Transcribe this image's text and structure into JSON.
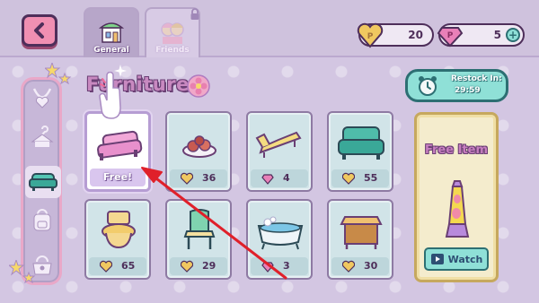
{
  "header": {
    "back_icon": "chevron-left-icon",
    "tabs": [
      {
        "label": "General",
        "icon": "shop-icon",
        "active": true
      },
      {
        "label": "Friends",
        "icon": "friends-icon",
        "active": false,
        "locked": true
      }
    ],
    "coins": {
      "value": "20",
      "icon": "coin-heart-icon"
    },
    "gems": {
      "value": "5",
      "icon": "gem-icon",
      "add_icon": "plus-icon"
    }
  },
  "title": "Furniture",
  "restock": {
    "label": "Restock In:",
    "time": "29:59"
  },
  "sidebar": {
    "items": [
      {
        "icon": "necklace-icon"
      },
      {
        "icon": "clothes-hanger-icon"
      },
      {
        "icon": "sofa-icon",
        "active": true
      },
      {
        "icon": "backpack-icon"
      },
      {
        "icon": "purse-icon"
      }
    ]
  },
  "items": [
    {
      "name": "pink-sofa",
      "price": "Free!",
      "currency": "none",
      "selected": true
    },
    {
      "name": "cupcake-plate",
      "price": "36",
      "currency": "coin"
    },
    {
      "name": "lounge-chair",
      "price": "4",
      "currency": "gem"
    },
    {
      "name": "teal-sofa",
      "price": "55",
      "currency": "coin"
    },
    {
      "name": "toilet",
      "price": "65",
      "currency": "coin"
    },
    {
      "name": "dining-chair",
      "price": "29",
      "currency": "coin"
    },
    {
      "name": "bathtub",
      "price": "3",
      "currency": "gem"
    },
    {
      "name": "side-table",
      "price": "30",
      "currency": "coin"
    }
  ],
  "free_item": {
    "title": "Free Item",
    "watch_label": "Watch",
    "watch_icon": "video-icon"
  },
  "colors": {
    "background": "#d3c6e2",
    "accent_pink": "#f08fb2",
    "teal": "#8fe0d7",
    "outline": "#4e2e5a",
    "arrow": "#e0202a"
  }
}
